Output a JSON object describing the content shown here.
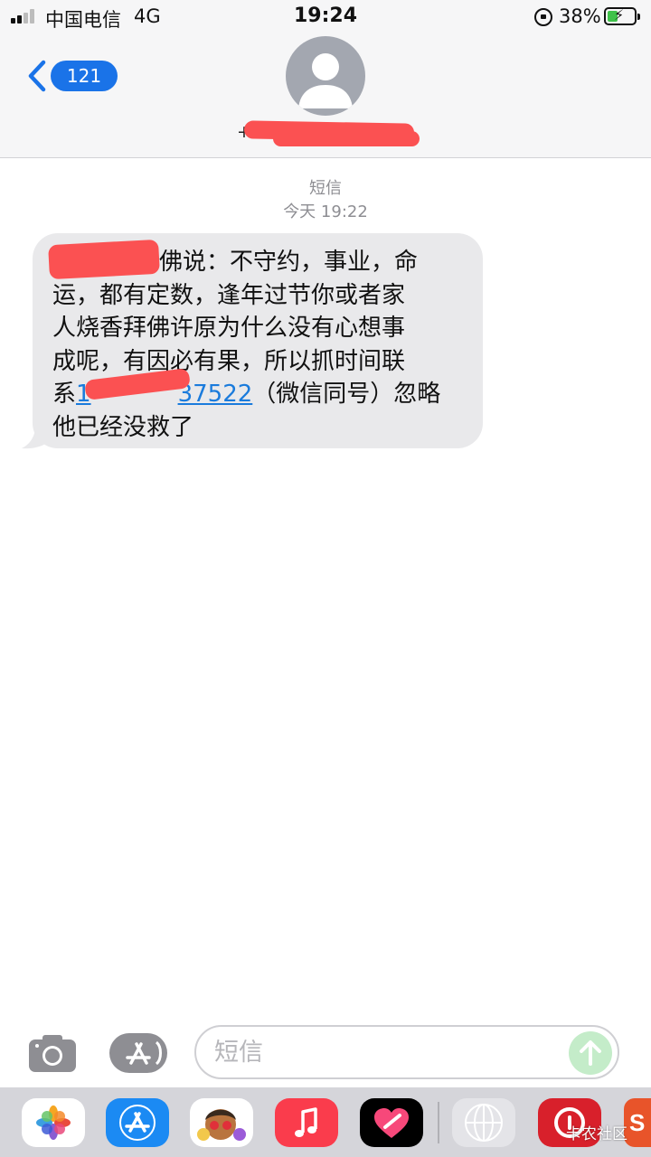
{
  "status_bar": {
    "carrier": "中国电信",
    "network": "4G",
    "time": "19:24",
    "battery": "38%",
    "battery_level": 0.38
  },
  "header": {
    "back_count": "121",
    "contact_number": "+86"
  },
  "thread": {
    "service_label": "短信",
    "timestamp": "今天 19:22"
  },
  "message": {
    "lines": [
      "佛说：不守约，事业，命",
      "运，都有定数，逢年过节你或者家",
      "人烧香拜佛许原为什么没有心想事",
      "成呢，有因必有果，所以抓时间联"
    ],
    "line5_prefix": "系",
    "phone_prefix": "1",
    "phone_suffix": "37522",
    "line5_suffix": "（微信同号）忽略",
    "line6": "他已经没救了"
  },
  "composer": {
    "placeholder": "短信"
  },
  "app_drawer": {
    "apps": [
      "photos-app",
      "app-store-app",
      "memoji-app",
      "music-app",
      "digital-touch-app",
      "unknown-app",
      "netease-music-app",
      "partial-app"
    ]
  },
  "watermark": "卡农社区",
  "colors": {
    "accent": "#1a73e8",
    "link": "#1a7bdc",
    "redaction": "#fb5152",
    "bubble": "#e9e9eb",
    "send": "#c4ecc9"
  }
}
